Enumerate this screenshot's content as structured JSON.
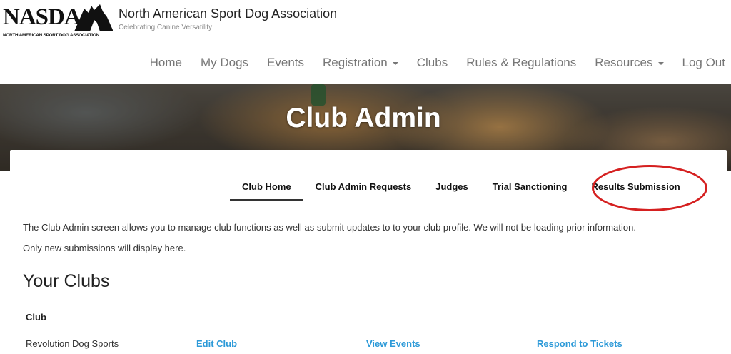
{
  "site": {
    "logo_text": "NASDA",
    "logo_subtext": "NORTH AMERICAN SPORT DOG ASSOCIATION",
    "title": "North American Sport Dog Association",
    "tagline": "Celebrating Canine Versatility"
  },
  "nav": {
    "items": [
      {
        "label": "Home",
        "dropdown": false
      },
      {
        "label": "My Dogs",
        "dropdown": false
      },
      {
        "label": "Events",
        "dropdown": false
      },
      {
        "label": "Registration",
        "dropdown": true
      },
      {
        "label": "Clubs",
        "dropdown": false
      },
      {
        "label": "Rules & Regulations",
        "dropdown": false
      },
      {
        "label": "Resources",
        "dropdown": true
      },
      {
        "label": "Log Out",
        "dropdown": false
      }
    ]
  },
  "hero": {
    "title": "Club Admin"
  },
  "tabs": [
    {
      "label": "Club Home",
      "active": true
    },
    {
      "label": "Club Admin Requests",
      "active": false
    },
    {
      "label": "Judges",
      "active": false
    },
    {
      "label": "Trial Sanctioning",
      "active": false
    },
    {
      "label": "Results Submission",
      "active": false
    }
  ],
  "intro": {
    "line1": "The Club Admin screen allows you to manage club functions as well as submit updates to to your club profile.  We will not be loading prior information.",
    "line2": "Only new submissions will display here."
  },
  "clubs": {
    "heading": "Your Clubs",
    "column_header": "Club",
    "rows": [
      {
        "name": "Revolution Dog Sports",
        "edit_label": "Edit Club",
        "events_label": "View Events",
        "tickets_label": "Respond to Tickets"
      }
    ]
  },
  "colors": {
    "link": "#2d9ad8",
    "highlight_ellipse": "#d52020",
    "nav_text": "#777777"
  },
  "icons": {
    "logo_mountain": "mountain-dog-silhouette-icon",
    "dropdown": "caret-down-icon"
  }
}
